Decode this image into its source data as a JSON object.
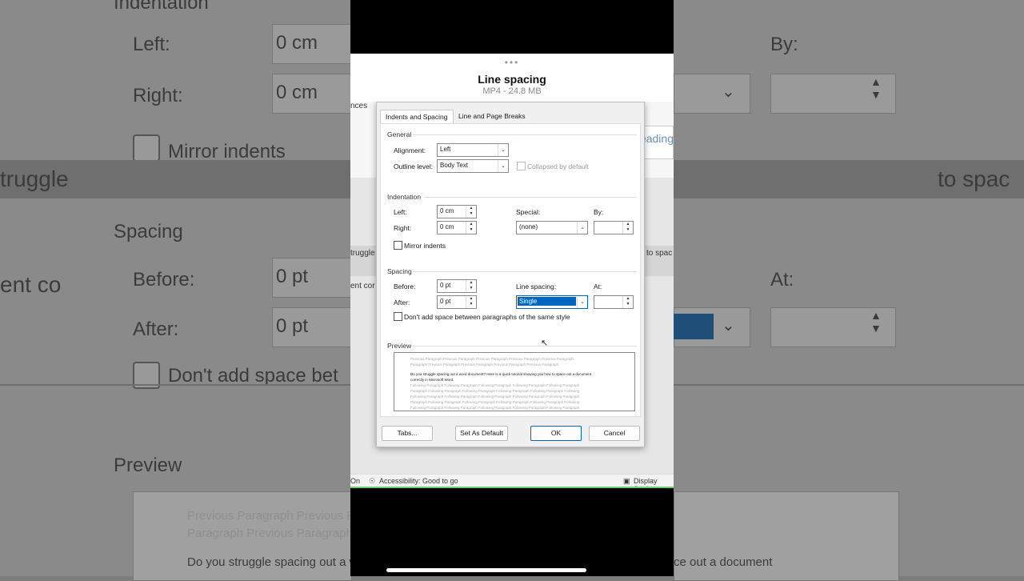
{
  "background": {
    "texts": [
      "Indentation",
      "Left:",
      "0 cm",
      "Right:",
      "0 cm",
      "Mirror indents",
      "truggle",
      "Spacing",
      "ent co",
      "Before:",
      "0 pt",
      "After:",
      "0 pt",
      "Don't add space bet",
      "Preview",
      "By:",
      "At:",
      "to spac",
      "Previous Paragraph Previous P",
      "Paragraph Previous Paragraph",
      "Do you struggle spacing out a w",
      "ce out a document"
    ]
  },
  "sheet": {
    "title": "Line spacing",
    "subtitle": "MP4 - 24.8 MB"
  },
  "ribbon": {
    "references_partial": "nces",
    "heading_partial": "eading"
  },
  "doc_side": {
    "left1": "truggle",
    "left2": "ent cor",
    "right1": "to spac"
  },
  "dialog": {
    "tabs": [
      "Indents and Spacing",
      "Line and Page Breaks"
    ],
    "general": {
      "heading": "General",
      "alignment_label": "Alignment:",
      "alignment_value": "Left",
      "outline_label": "Outline level:",
      "outline_value": "Body Text",
      "collapsed_label": "Collapsed by default"
    },
    "indentation": {
      "heading": "Indentation",
      "left_label": "Left:",
      "left_value": "0 cm",
      "right_label": "Right:",
      "right_value": "0 cm",
      "special_label": "Special:",
      "special_value": "(none)",
      "by_label": "By:",
      "by_value": "",
      "mirror_label": "Mirror indents"
    },
    "spacing": {
      "heading": "Spacing",
      "before_label": "Before:",
      "before_value": "0 pt",
      "after_label": "After:",
      "after_value": "0 pt",
      "line_spacing_label": "Line spacing:",
      "line_spacing_value": "Single",
      "at_label": "At:",
      "at_value": "",
      "dont_add_label": "Don't add space between paragraphs of the same style"
    },
    "preview": {
      "heading": "Preview",
      "prev1": "Previous Paragraph Previous Paragraph Previous Paragraph Previous Paragraph Previous Paragraph",
      "prev2": "Paragraph Previous Paragraph Previous Paragraph Previous Paragraph Previous Paragraph",
      "body1": "Do you struggle spacing out a word document? Here is a quick tutorial showing you how to space out a document",
      "body2": "correctly in Microsoft Word.",
      "follow1": "Following Paragraph Following Paragraph Following Paragraph Following Paragraph Following Paragraph",
      "follow2": "Paragraph Following Paragraph Following Paragraph Following Paragraph Following Paragraph Following",
      "follow3": "Following Paragraph Following Paragraph Following Paragraph Following Paragraph Following Paragraph",
      "follow4": "Paragraph Following Paragraph Following Paragraph Following Paragraph Following Paragraph Following",
      "follow5": "Following Paragraph Following Paragraph Following Paragraph Following Paragraph Following Paragraph"
    },
    "buttons": {
      "tabs": "Tabs...",
      "set_default": "Set As Default",
      "ok": "OK",
      "cancel": "Cancel"
    }
  },
  "status": {
    "left_partial": "On",
    "accessibility": "Accessibility: Good to go",
    "display": "Display Settin"
  },
  "colors": {
    "accent": "#0067c0",
    "green_line": "#6ccf6c"
  }
}
